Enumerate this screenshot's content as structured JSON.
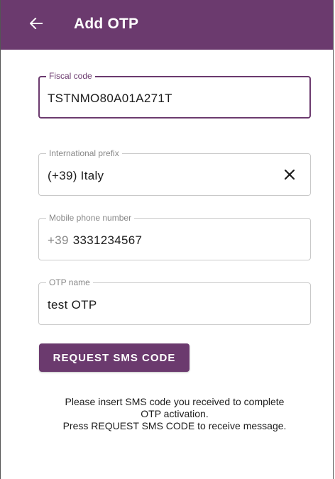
{
  "appbar": {
    "title": "Add OTP",
    "back_icon": "arrow-left-icon",
    "color": "#6b3a6e"
  },
  "form": {
    "fiscal_code": {
      "label": "Fiscal code",
      "value": "TSTNMO80A01A271T"
    },
    "international_prefix": {
      "label": "International prefix",
      "value": "(+39) Italy",
      "clear_icon": "close-icon"
    },
    "mobile_phone": {
      "label": "Mobile phone number",
      "prefix": "+39",
      "value": "3331234567"
    },
    "otp_name": {
      "label": "OTP name",
      "value": "test OTP"
    }
  },
  "request_button": {
    "label": "REQUEST SMS CODE"
  },
  "info": {
    "line1": "Please insert SMS code you received to complete",
    "line2": "OTP activation.",
    "line3": "Press REQUEST SMS CODE to receive message."
  }
}
